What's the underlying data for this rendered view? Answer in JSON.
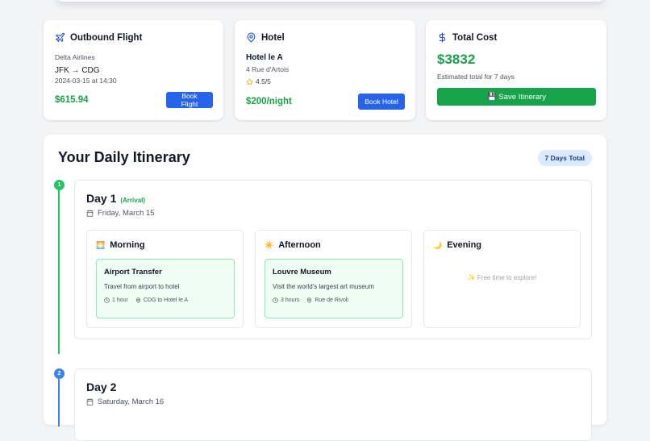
{
  "flight": {
    "title": "Outbound Flight",
    "airline": "Delta Airlines",
    "route": "JFK → CDG",
    "datetime": "2024-03-15 at 14:30",
    "price": "$615.94",
    "button": "Book Flight",
    "icon": "plane-icon"
  },
  "hotel": {
    "title": "Hotel",
    "name": "Hotel le A",
    "address": "4 Rue d'Artois",
    "rating": "4.5/5",
    "price": "$200/night",
    "button": "Book Hotel",
    "icon": "map-pin-icon"
  },
  "cost": {
    "title": "Total Cost",
    "amount": "$3832",
    "note": "Estimated total for 7 days",
    "button": "💾 Save Itinerary",
    "icon": "dollar-icon"
  },
  "itinerary": {
    "title": "Your Daily Itinerary",
    "badge": "7 Days Total"
  },
  "days": [
    {
      "number": "1",
      "title": "Day 1",
      "tag": "(Arrival)",
      "date": "Friday, March 15",
      "periods": {
        "morning": {
          "emoji": "🌅",
          "label": "Morning",
          "activity": {
            "title": "Airport Transfer",
            "desc": "Travel from airport to hotel",
            "duration": "1 hour",
            "location": "CDG to Hotel le A"
          }
        },
        "afternoon": {
          "emoji": "☀️",
          "label": "Afternoon",
          "activity": {
            "title": "Louvre Museum",
            "desc": "Visit the world's largest art museum",
            "duration": "3 hours",
            "location": "Rue de Rivoli"
          }
        },
        "evening": {
          "emoji": "🌙",
          "label": "Evening",
          "empty": "✨ Free time to explore!"
        }
      }
    },
    {
      "number": "2",
      "title": "Day 2",
      "date": "Saturday, March 16"
    }
  ],
  "colors": {
    "green": "#16a34a",
    "blue": "#2563eb",
    "green_save": "#16a34a",
    "timeline_green": "#22c55e",
    "timeline_blue": "#3b82f6"
  }
}
